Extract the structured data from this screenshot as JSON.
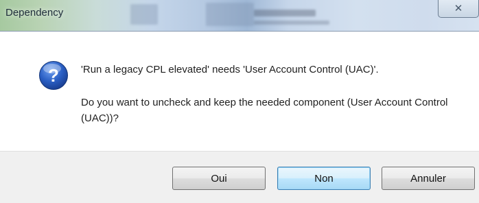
{
  "window": {
    "title": "Dependency",
    "close_glyph": "✕"
  },
  "dialog": {
    "icon": "question-icon",
    "message_line1": "'Run a legacy CPL elevated' needs 'User Account Control (UAC)'.",
    "message_line2": "Do you want to uncheck and keep the needed component (User Account Control (UAC))?"
  },
  "buttons": {
    "yes_label": "Oui",
    "no_label": "Non",
    "cancel_label": "Annuler"
  },
  "colors": {
    "icon_blue": "#2a5fc4",
    "default_button_border": "#3c7fb1"
  }
}
